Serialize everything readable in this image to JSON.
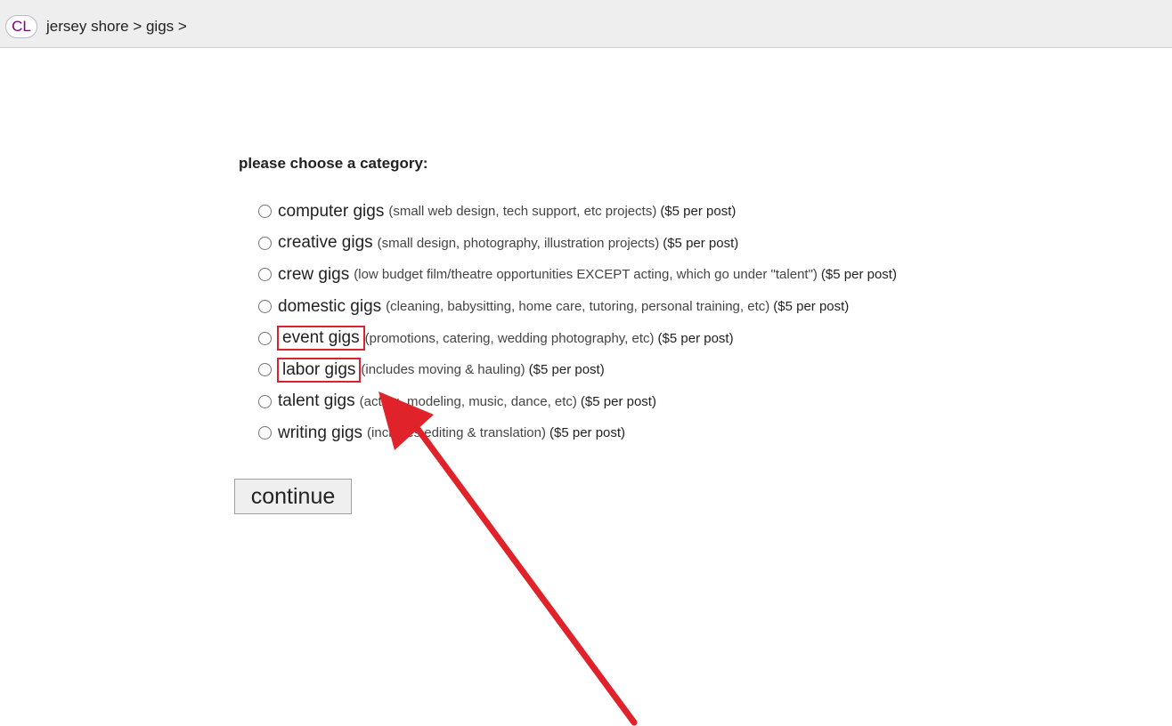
{
  "header": {
    "logo_text": "CL",
    "breadcrumb": "jersey shore > gigs >"
  },
  "form": {
    "heading": "please choose a category:",
    "options": [
      {
        "label": "computer gigs",
        "description": "(small web design, tech support, etc projects)",
        "price": "($5 per post)",
        "highlighted": false
      },
      {
        "label": "creative gigs",
        "description": "(small design, photography, illustration projects)",
        "price": "($5 per post)",
        "highlighted": false
      },
      {
        "label": "crew gigs",
        "description": "(low budget film/theatre opportunities EXCEPT acting, which go under \"talent\")",
        "price": "($5 per post)",
        "highlighted": false
      },
      {
        "label": "domestic gigs",
        "description": "(cleaning, babysitting, home care, tutoring, personal training, etc)",
        "price": "($5 per post)",
        "highlighted": false
      },
      {
        "label": "event gigs",
        "description": "(promotions, catering, wedding photography, etc)",
        "price": "($5 per post)",
        "highlighted": true
      },
      {
        "label": "labor gigs",
        "description": "(includes moving & hauling)",
        "price": "($5 per post)",
        "highlighted": true
      },
      {
        "label": "talent gigs",
        "description": "(acting, modeling, music, dance, etc)",
        "price": "($5 per post)",
        "highlighted": false
      },
      {
        "label": "writing gigs",
        "description": "(includes editing & translation)",
        "price": "($5 per post)",
        "highlighted": false
      }
    ],
    "continue_label": "continue"
  },
  "annotation": {
    "arrow_color": "#e0232b",
    "highlight_color": "#d8242f"
  }
}
